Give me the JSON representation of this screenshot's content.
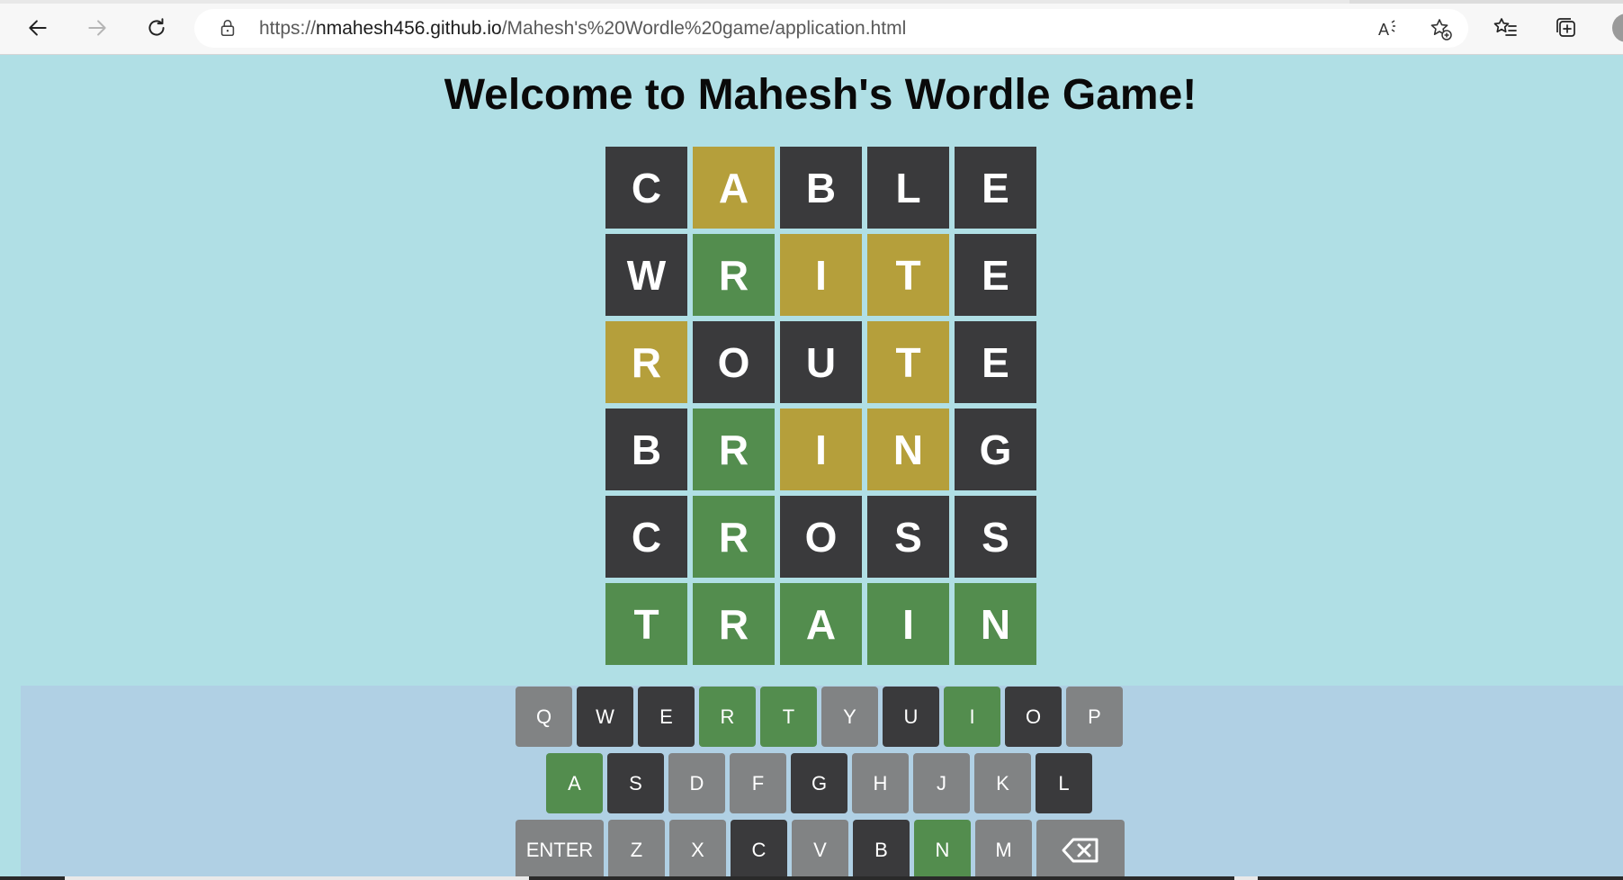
{
  "browser": {
    "url_prefix": "https://",
    "url_host": "nmahesh456.github.io",
    "url_path": "/Mahesh's%20Wordle%20game/application.html"
  },
  "page": {
    "title": "Welcome to Mahesh's Wordle Game!"
  },
  "board": {
    "rows": [
      {
        "letters": [
          "C",
          "A",
          "B",
          "L",
          "E"
        ],
        "states": [
          "absent",
          "present",
          "absent",
          "absent",
          "absent"
        ]
      },
      {
        "letters": [
          "W",
          "R",
          "I",
          "T",
          "E"
        ],
        "states": [
          "absent",
          "correct",
          "present",
          "present",
          "absent"
        ]
      },
      {
        "letters": [
          "R",
          "O",
          "U",
          "T",
          "E"
        ],
        "states": [
          "present",
          "absent",
          "absent",
          "present",
          "absent"
        ]
      },
      {
        "letters": [
          "B",
          "R",
          "I",
          "N",
          "G"
        ],
        "states": [
          "absent",
          "correct",
          "present",
          "present",
          "absent"
        ]
      },
      {
        "letters": [
          "C",
          "R",
          "O",
          "S",
          "S"
        ],
        "states": [
          "absent",
          "correct",
          "absent",
          "absent",
          "absent"
        ]
      },
      {
        "letters": [
          "T",
          "R",
          "A",
          "I",
          "N"
        ],
        "states": [
          "correct",
          "correct",
          "correct",
          "correct",
          "correct"
        ]
      }
    ]
  },
  "keyboard": {
    "row1": [
      {
        "label": "Q",
        "state": "unused"
      },
      {
        "label": "W",
        "state": "absent"
      },
      {
        "label": "E",
        "state": "absent"
      },
      {
        "label": "R",
        "state": "correct"
      },
      {
        "label": "T",
        "state": "correct"
      },
      {
        "label": "Y",
        "state": "unused"
      },
      {
        "label": "U",
        "state": "absent"
      },
      {
        "label": "I",
        "state": "correct"
      },
      {
        "label": "O",
        "state": "absent"
      },
      {
        "label": "P",
        "state": "unused"
      }
    ],
    "row2": [
      {
        "label": "A",
        "state": "correct"
      },
      {
        "label": "S",
        "state": "absent"
      },
      {
        "label": "D",
        "state": "unused"
      },
      {
        "label": "F",
        "state": "unused"
      },
      {
        "label": "G",
        "state": "absent"
      },
      {
        "label": "H",
        "state": "unused"
      },
      {
        "label": "J",
        "state": "unused"
      },
      {
        "label": "K",
        "state": "unused"
      },
      {
        "label": "L",
        "state": "absent"
      }
    ],
    "row3": [
      {
        "label": "ENTER",
        "state": "unused",
        "wide": true
      },
      {
        "label": "Z",
        "state": "unused"
      },
      {
        "label": "X",
        "state": "unused"
      },
      {
        "label": "C",
        "state": "absent"
      },
      {
        "label": "V",
        "state": "unused"
      },
      {
        "label": "B",
        "state": "absent"
      },
      {
        "label": "N",
        "state": "correct"
      },
      {
        "label": "M",
        "state": "unused"
      },
      {
        "label": "",
        "state": "unused",
        "wide": true,
        "icon": "backspace-icon"
      }
    ]
  },
  "colors": {
    "page_background": "#b0dfe5",
    "keyboard_background": "#b0d0e4",
    "absent": "#3a3a3c",
    "present": "#b59f3b",
    "correct": "#538d4e",
    "unused": "#818384"
  }
}
